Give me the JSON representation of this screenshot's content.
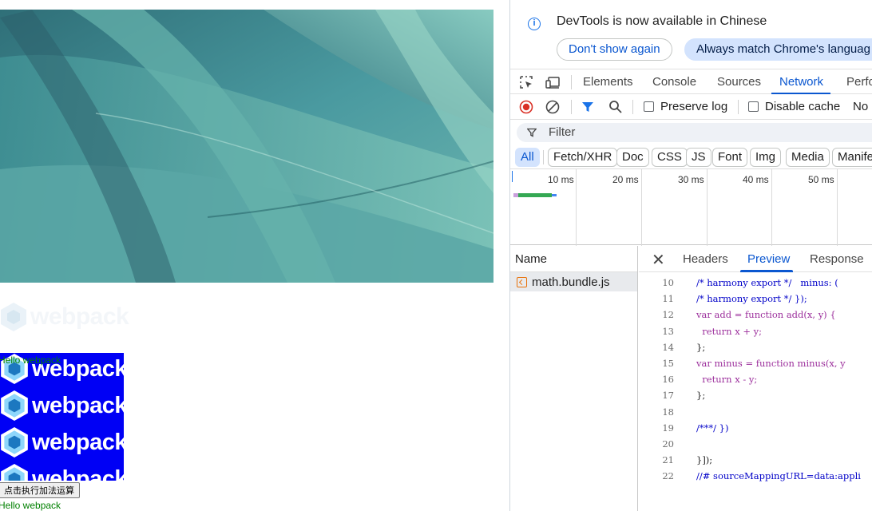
{
  "page": {
    "faded_logo_text": "webpack",
    "tile_logo_text": "webpack",
    "overlay_text": "Hello webpack",
    "calc_button": "点击执行加法运算",
    "hello_text": "Hello webpack"
  },
  "devtools": {
    "banner": {
      "message": "DevTools is now available in Chinese",
      "dont_show": "Don't show again",
      "always_match": "Always match Chrome's languag"
    },
    "tabs": [
      "Elements",
      "Console",
      "Sources",
      "Network",
      "Perfo"
    ],
    "active_tab": "Network",
    "toolbar": {
      "preserve_log": "Preserve log",
      "disable_cache": "Disable cache",
      "throttle": "No"
    },
    "filter_placeholder": "Filter",
    "type_filters": [
      "All",
      "Fetch/XHR",
      "Doc",
      "CSS",
      "JS",
      "Font",
      "Img",
      "Media",
      "Manife"
    ],
    "timeline_labels": [
      "10 ms",
      "20 ms",
      "30 ms",
      "40 ms",
      "50 ms"
    ],
    "name_header": "Name",
    "requests": [
      "math.bundle.js"
    ],
    "detail_tabs": [
      "Headers",
      "Preview",
      "Response"
    ],
    "active_detail_tab": "Preview",
    "code_lines": [
      {
        "n": "10",
        "text": "/* harmony export */   minus: ("
      },
      {
        "n": "11",
        "text": "/* harmony export */ });"
      },
      {
        "n": "12",
        "text": "var add = function add(x, y) {"
      },
      {
        "n": "13",
        "text": "  return x + y;"
      },
      {
        "n": "14",
        "text": "};"
      },
      {
        "n": "15",
        "text": "var minus = function minus(x, y"
      },
      {
        "n": "16",
        "text": "  return x - y;"
      },
      {
        "n": "17",
        "text": "};"
      },
      {
        "n": "18",
        "text": ""
      },
      {
        "n": "19",
        "text": "/***/ })"
      },
      {
        "n": "20",
        "text": ""
      },
      {
        "n": "21",
        "text": "}]);"
      },
      {
        "n": "22",
        "text": "//# sourceMappingURL=data:appli"
      }
    ]
  },
  "colors": {
    "accent": "#0b57d0",
    "tile_bg": "#0000f5",
    "hello_green": "#008000"
  }
}
